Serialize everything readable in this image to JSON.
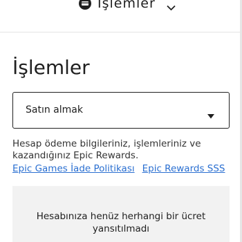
{
  "header": {
    "title": "İşlemler",
    "icon": "transactions-icon",
    "menu_icon": "chevron-down-icon"
  },
  "main": {
    "title": "İşlemler",
    "filter": {
      "selected": "Satın almak"
    },
    "description": "Hesap ödeme bilgileriniz, işlemleriniz ve kazandığınız Epic Rewards.",
    "links": [
      {
        "label": "Epic Games İade Politikası"
      },
      {
        "label": "Epic Rewards SSS"
      }
    ],
    "empty_message": "Hesabınıza henüz herhangi bir ücret yansıtılmadı"
  }
}
